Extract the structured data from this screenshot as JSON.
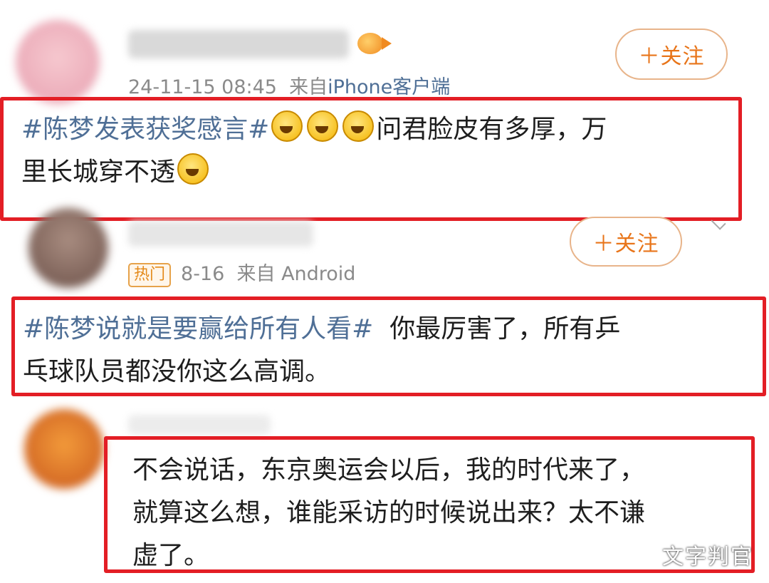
{
  "comment1": {
    "time": "24-11-15 08:45",
    "source_prefix": "来自",
    "source": "iPhone客户端",
    "follow_label": "＋关注",
    "hashtag": "#陈梦发表获奖感言#",
    "text_after_emoji": "问君脸皮有多厚，万",
    "line2": "里长城穿不透",
    "emojis": [
      "crying-laugh-emoji",
      "crying-laugh-emoji",
      "crying-laugh-emoji",
      "laughing-emoji"
    ]
  },
  "comment2": {
    "badge": "热门",
    "time": "8-16",
    "source_prefix": "来自",
    "source": "Android",
    "follow_label": "＋关注",
    "hashtag": "#陈梦说就是要赢给所有人看#",
    "text": "你最厉害了，所有乒",
    "line2": "乓球队员都没你这么高调。"
  },
  "comment3": {
    "line1": "不会说话，东京奥运会以后，我的时代来了，",
    "line2": "就算这么想，谁能采访的时候说出来？太不谦",
    "line3": "虚了。"
  },
  "watermark": "文字判官",
  "colors": {
    "highlight_box": "#e31e25",
    "hashtag": "#4f6f96",
    "follow": "#e8751a"
  }
}
